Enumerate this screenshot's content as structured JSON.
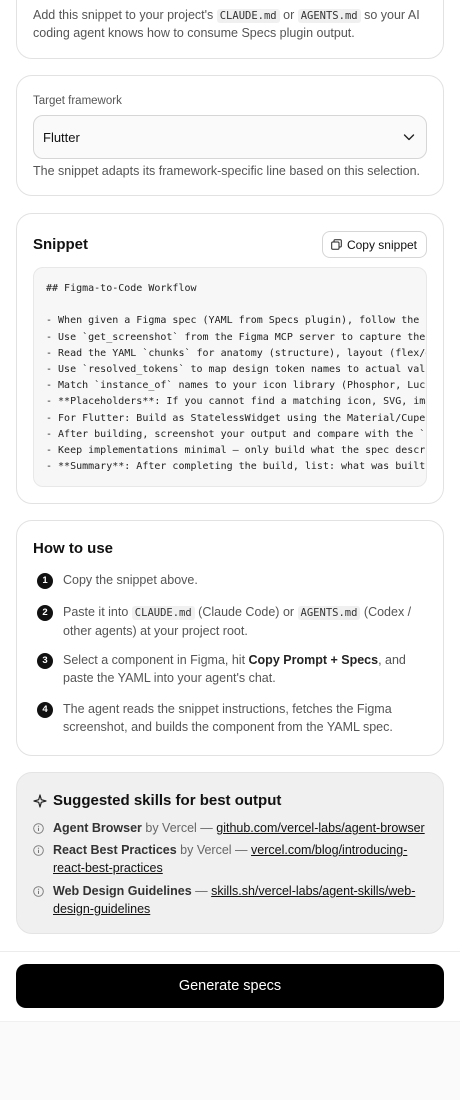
{
  "intro": {
    "text_pre": "Add this snippet to your project's ",
    "file1": "CLAUDE.md",
    "text_or": " or ",
    "file2": "AGENTS.md",
    "text_post": " so your AI coding agent knows how to consume Specs plugin output."
  },
  "framework": {
    "label": "Target framework",
    "selected": "Flutter",
    "help": "The snippet adapts its framework-specific line based on this selection."
  },
  "snippet": {
    "title": "Snippet",
    "copy_label": "Copy snippet",
    "lines": [
      "## Figma-to-Code Workflow",
      "",
      "- When given a Figma spec (YAML from Specs plugin), follow the i",
      "- Use `get_screenshot` from the Figma MCP server to capture the ",
      "- Read the YAML `chunks` for anatomy (structure), layout (flex/g",
      "- Use `resolved_tokens` to map design token names to actual valu",
      "- Match `instance_of` names to your icon library (Phosphor, Luci",
      "- **Placeholders**: If you cannot find a matching icon, SVG, ima",
      "- For Flutter: Build as StatelessWidget using the Material/Cuper",
      "- After building, screenshot your output and compare with the `.",
      "- Keep implementations minimal — only build what the spec descri",
      "- **Summary**: After completing the build, list: what was built "
    ]
  },
  "how": {
    "title": "How to use",
    "steps": [
      {
        "num": "1",
        "text": "Copy the snippet above."
      },
      {
        "num": "2",
        "pre": "Paste it into ",
        "code1": "CLAUDE.md",
        "mid": " (Claude Code) or ",
        "code2": "AGENTS.md",
        "post": " (Codex / other agents) at your project root."
      },
      {
        "num": "3",
        "pre": "Select a component in Figma, hit ",
        "bold": "Copy Prompt + Specs",
        "post": ", and paste the YAML into your agent's chat."
      },
      {
        "num": "4",
        "text": "The agent reads the snippet instructions, fetches the Figma screenshot, and builds the component from the YAML spec."
      }
    ]
  },
  "skills": {
    "title": "Suggested skills for best output",
    "items": [
      {
        "name": "Agent Browser",
        "by": " by Vercel — ",
        "link": "github.com/vercel-labs/agent-browser"
      },
      {
        "name": "React Best Practices",
        "by": " by Vercel — ",
        "link": "vercel.com/blog/introducing-react-best-practices"
      },
      {
        "name": "Web Design Guidelines",
        "by": " — ",
        "link": "skills.sh/vercel-labs/agent-skills/web-design-guidelines"
      }
    ]
  },
  "footer": {
    "generate_label": "Generate specs"
  },
  "icons": {
    "chevron": "chevron-down-icon",
    "copy": "copy-icon",
    "sparkle": "sparkle-icon",
    "info": "info-icon"
  },
  "colors": {
    "primary_button": "#000000",
    "skills_bg": "#f0f0f0"
  }
}
